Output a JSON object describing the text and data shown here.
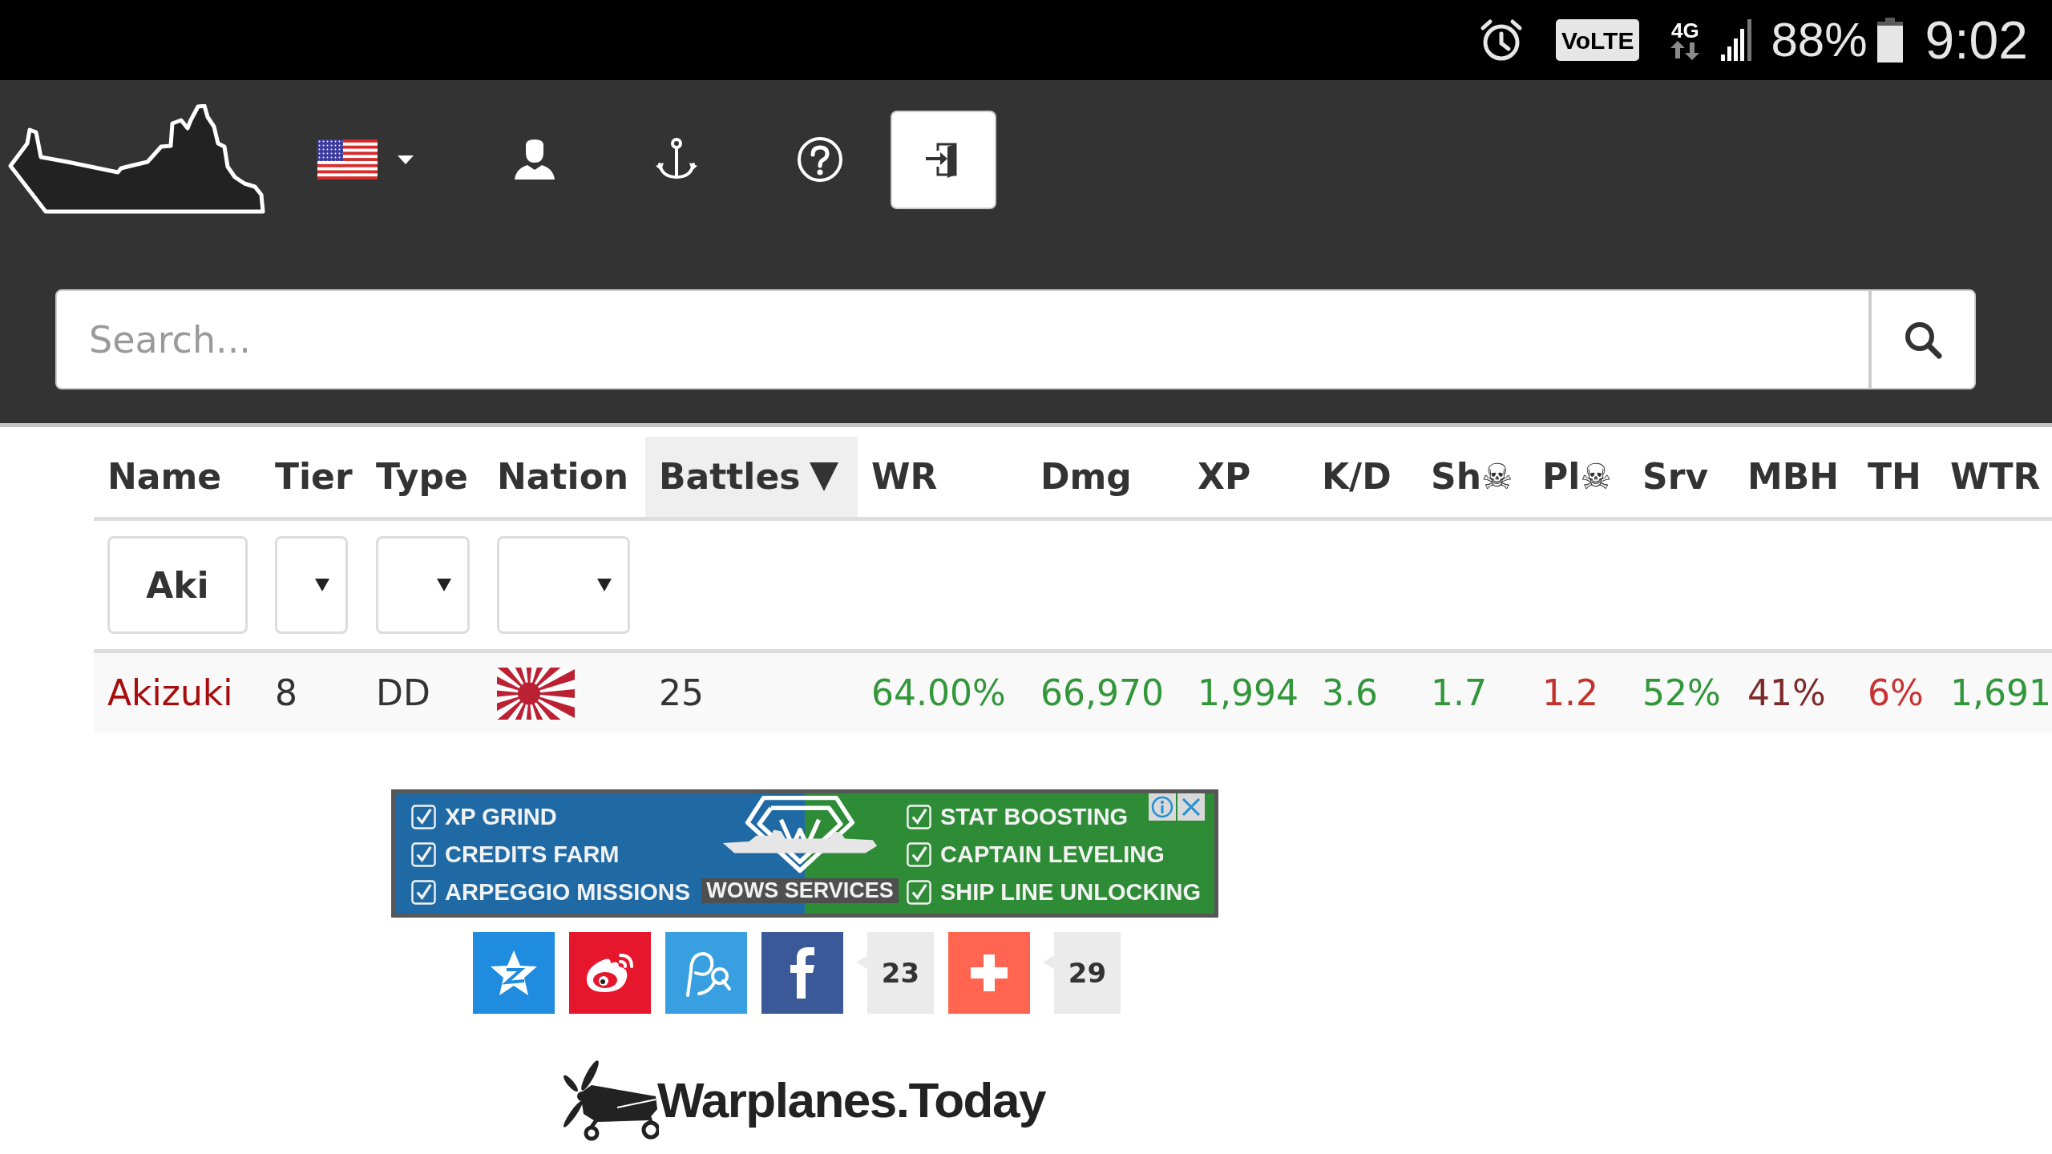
{
  "status_bar": {
    "volte": "VoLTE",
    "network": "4G",
    "battery": "88%",
    "time": "9:02"
  },
  "search": {
    "placeholder": "Search..."
  },
  "table": {
    "columns": [
      {
        "label": "Name",
        "sorted": false
      },
      {
        "label": "Tier",
        "sorted": false
      },
      {
        "label": "Type",
        "sorted": false
      },
      {
        "label": "Nation",
        "sorted": false
      },
      {
        "label": "Battles",
        "sorted": true
      },
      {
        "label": "WR",
        "sorted": false
      },
      {
        "label": "Dmg",
        "sorted": false
      },
      {
        "label": "XP",
        "sorted": false
      },
      {
        "label": "K/D",
        "sorted": false
      },
      {
        "label": "Sh☠",
        "sorted": false
      },
      {
        "label": "Pl☠",
        "sorted": false
      },
      {
        "label": "Srv",
        "sorted": false
      },
      {
        "label": "MBH",
        "sorted": false
      },
      {
        "label": "TH",
        "sorted": false
      },
      {
        "label": "WTR",
        "sorted": false
      }
    ],
    "filters": [
      {
        "kind": "text",
        "value": "Aki"
      },
      {
        "kind": "select"
      },
      {
        "kind": "select"
      },
      {
        "kind": "select"
      }
    ],
    "rows": [
      {
        "cells": [
          {
            "kind": "link",
            "text": "Akizuki",
            "color": "#a80d0d"
          },
          {
            "kind": "text",
            "text": "8"
          },
          {
            "kind": "text",
            "text": "DD"
          },
          {
            "kind": "flag"
          },
          {
            "kind": "text",
            "text": "25"
          },
          {
            "kind": "text",
            "text": "64.00%",
            "color": "#32963a"
          },
          {
            "kind": "text",
            "text": "66,970",
            "color": "#32963a"
          },
          {
            "kind": "text",
            "text": "1,994",
            "color": "#32963a"
          },
          {
            "kind": "text",
            "text": "3.6",
            "color": "#32963a"
          },
          {
            "kind": "text",
            "text": "1.7",
            "color": "#32963a"
          },
          {
            "kind": "text",
            "text": "1.2",
            "color": "#c4302b"
          },
          {
            "kind": "text",
            "text": "52%",
            "color": "#32963a"
          },
          {
            "kind": "text",
            "text": "41%",
            "color": "#7d2a2a"
          },
          {
            "kind": "text",
            "text": "6%",
            "color": "#c83232"
          },
          {
            "kind": "text",
            "text": "1,691",
            "color": "#32963a"
          }
        ]
      }
    ]
  },
  "ad": {
    "left": [
      {
        "label": "XP GRIND",
        "checked": true
      },
      {
        "label": "CREDITS FARM",
        "checked": true
      },
      {
        "label": "ARPEGGIO MISSIONS",
        "checked": true
      }
    ],
    "title": "WOWS SERVICES",
    "right": [
      {
        "label": "STAT BOOSTING",
        "checked": true
      },
      {
        "label": "CAPTAIN LEVELING",
        "checked": true
      },
      {
        "label": "SHIP LINE UNLOCKING",
        "checked": true
      }
    ]
  },
  "share": [
    {
      "kind": "button",
      "color": "#1f8ce0"
    },
    {
      "kind": "button",
      "color": "#e6162d"
    },
    {
      "kind": "button",
      "color": "#38a0e0"
    },
    {
      "kind": "button",
      "color": "#3b5998"
    },
    {
      "kind": "count",
      "text": "23"
    },
    {
      "kind": "button",
      "color": "#ff6550"
    },
    {
      "kind": "count",
      "text": "29"
    }
  ],
  "footer_logo": {
    "text": "Warplanes.Today"
  }
}
